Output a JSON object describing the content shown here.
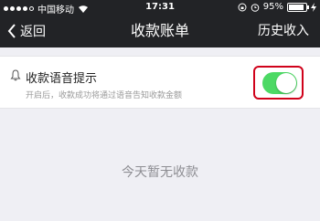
{
  "status_bar": {
    "carrier": "中国移动",
    "time": "17:31",
    "battery": "95%",
    "signal_icon": "signal-dots-icon",
    "wifi_icon": "wifi-icon",
    "lock_icon": "orientation-lock-icon",
    "alarm_icon": "alarm-icon",
    "charge_icon": "charging-bolt-icon"
  },
  "nav": {
    "back_label": "返回",
    "title": "收款账单",
    "right_label": "历史收入"
  },
  "voice_setting": {
    "title": "收款语音提示",
    "description": "开启后，收款成功将通过语音告知收款金额",
    "enabled": true,
    "toggle_color": "#4cd964"
  },
  "empty_message": "今天暂无收款",
  "colors": {
    "bar_background": "#222326",
    "page_background": "#efeff4",
    "highlight": "#d0021b"
  }
}
